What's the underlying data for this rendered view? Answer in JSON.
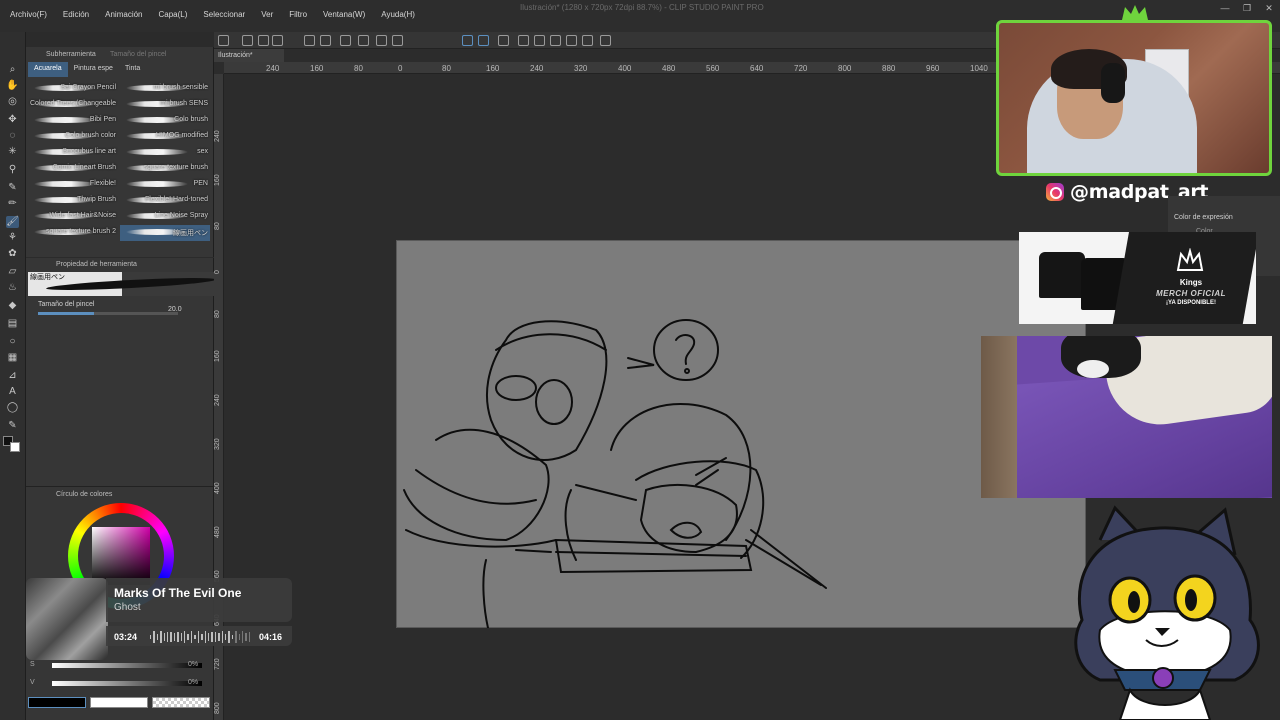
{
  "window": {
    "title": "Ilustración* (1280 x 720px 72dpi 88.7%)  - CLIP STUDIO PAINT PRO",
    "menu": [
      "Archivo(F)",
      "Edición",
      "Animación",
      "Capa(L)",
      "Seleccionar",
      "Ver",
      "Filtro",
      "Ventana(W)",
      "Ayuda(H)"
    ],
    "controls": [
      "—",
      "❐",
      "✕"
    ]
  },
  "document_tab": "Ilustración*",
  "subtool_panel": {
    "header": "Subherramienta",
    "header2": "Tamaño del pincel",
    "tabs": [
      "Acuarela",
      "Pintura espe",
      "Tinta"
    ],
    "brushes": [
      "Sai Crayon Pencil",
      "mi brush sensible",
      "Colored Trees (Changeable",
      "mi brush SENS",
      "Bibi Pen",
      "Colo brush",
      "Colo brush color",
      "HIMOG modified",
      "Succubus line art",
      "sex",
      "Comic Lineart Brush",
      "square texture brush",
      "Flexible!",
      "PEN",
      "Thwip Brush",
      "Flexible! Hard-toned",
      "Wide fast Hair&Noise",
      "Line Noise Spray",
      "square texture brush 2",
      "線画用ペン"
    ],
    "selected_index": 19
  },
  "tool_property": {
    "header": "Propiedad de herramienta",
    "brush_name": "線画用ペン",
    "size_label": "Tamaño del pincel",
    "size_value": "20.0",
    "size_fraction": 0.4
  },
  "color_panel": {
    "header": "Círculo de colores",
    "main_color": "#c800a0",
    "bars": [
      {
        "label": "S",
        "value": "0%"
      },
      {
        "label": "V",
        "value": "0%"
      }
    ]
  },
  "ruler": {
    "top": [
      "240",
      "160",
      "80",
      "0",
      "80",
      "160",
      "240",
      "320",
      "400",
      "480",
      "560",
      "640",
      "720",
      "800",
      "880",
      "960",
      "1040"
    ],
    "left": [
      "240",
      "160",
      "80",
      "0",
      "80",
      "160",
      "240",
      "320",
      "400",
      "480",
      "560",
      "640",
      "720",
      "800"
    ]
  },
  "overlay": {
    "handle": "@madpat_art",
    "merch": {
      "brand": "Kings",
      "line1": "MERCH OFICIAL",
      "line2": "¡YA DISPONIBLE!"
    },
    "music": {
      "title": "Marks Of The Evil One",
      "artist": "Ghost",
      "current": "03:24",
      "total": "04:16",
      "progress": 0.8
    }
  },
  "right_panel": {
    "label": "Color de expresión",
    "value": "Color"
  },
  "colors": {
    "accent": "#3e5f80",
    "webcam_border": "#6fd43d",
    "paper": "#7c7c7c"
  }
}
